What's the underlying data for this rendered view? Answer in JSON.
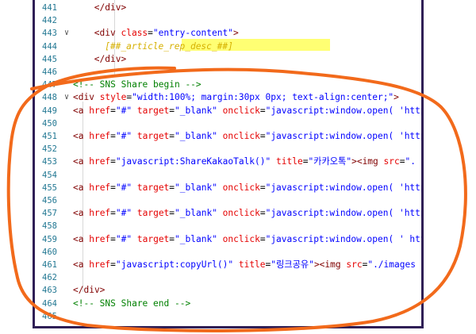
{
  "editor": {
    "highlight_color": "#ffff00",
    "annotation_color": "#f26a1b",
    "frame_color": "#2f1f56",
    "lines": [
      {
        "n": "441",
        "fold": "",
        "tokens": [
          {
            "c": "tag",
            "t": "</div>"
          }
        ],
        "indent": 4
      },
      {
        "n": "442",
        "fold": "",
        "tokens": [],
        "indent": 0
      },
      {
        "n": "443",
        "fold": "∨",
        "tokens": [
          {
            "c": "tag",
            "t": "<div "
          },
          {
            "c": "attr",
            "t": "class"
          },
          {
            "c": "txt",
            "t": "="
          },
          {
            "c": "str",
            "t": "\"entry-content\""
          },
          {
            "c": "tag",
            "t": ">"
          }
        ],
        "indent": 4
      },
      {
        "n": "444",
        "fold": "",
        "tokens": [
          {
            "c": "ph",
            "t": "[##_article_rep_desc_##]"
          }
        ],
        "indent": 6
      },
      {
        "n": "445",
        "fold": "",
        "tokens": [
          {
            "c": "tag",
            "t": "</div>"
          }
        ],
        "indent": 4
      },
      {
        "n": "446",
        "fold": "",
        "tokens": [],
        "indent": 0
      },
      {
        "n": "447",
        "fold": "",
        "tokens": [
          {
            "c": "com",
            "t": "<!-- SNS Share begin -->"
          }
        ],
        "indent": 0
      },
      {
        "n": "448",
        "fold": "∨",
        "tokens": [
          {
            "c": "tag",
            "t": "<div "
          },
          {
            "c": "attr",
            "t": "style"
          },
          {
            "c": "txt",
            "t": "="
          },
          {
            "c": "str",
            "t": "\"width:100%; margin:30px 0px; text-align:center;\""
          },
          {
            "c": "tag",
            "t": ">"
          }
        ],
        "indent": 0
      },
      {
        "n": "449",
        "fold": "",
        "tokens": [
          {
            "c": "tag",
            "t": "<a "
          },
          {
            "c": "attr",
            "t": "href"
          },
          {
            "c": "txt",
            "t": "="
          },
          {
            "c": "str",
            "t": "\"#\" "
          },
          {
            "c": "attr",
            "t": "target"
          },
          {
            "c": "txt",
            "t": "="
          },
          {
            "c": "str",
            "t": "\"_blank\" "
          },
          {
            "c": "attr",
            "t": "onclick"
          },
          {
            "c": "txt",
            "t": "="
          },
          {
            "c": "str",
            "t": "\"javascript:window.open( 'http"
          }
        ],
        "indent": 0
      },
      {
        "n": "450",
        "fold": "",
        "tokens": [],
        "indent": 0
      },
      {
        "n": "451",
        "fold": "",
        "tokens": [
          {
            "c": "tag",
            "t": "<a "
          },
          {
            "c": "attr",
            "t": "href"
          },
          {
            "c": "txt",
            "t": "="
          },
          {
            "c": "str",
            "t": "\"#\" "
          },
          {
            "c": "attr",
            "t": "target"
          },
          {
            "c": "txt",
            "t": "="
          },
          {
            "c": "str",
            "t": "\"_blank\" "
          },
          {
            "c": "attr",
            "t": "onclick"
          },
          {
            "c": "txt",
            "t": "="
          },
          {
            "c": "str",
            "t": "\"javascript:window.open( 'http"
          }
        ],
        "indent": 0
      },
      {
        "n": "452",
        "fold": "",
        "tokens": [],
        "indent": 0
      },
      {
        "n": "453",
        "fold": "",
        "tokens": [
          {
            "c": "tag",
            "t": "<a "
          },
          {
            "c": "attr",
            "t": "href"
          },
          {
            "c": "txt",
            "t": "="
          },
          {
            "c": "str",
            "t": "\"javascript:ShareKakaoTalk()\" "
          },
          {
            "c": "attr",
            "t": "title"
          },
          {
            "c": "txt",
            "t": "="
          },
          {
            "c": "str",
            "t": "\"카카오톡\""
          },
          {
            "c": "tag",
            "t": "><img "
          },
          {
            "c": "attr",
            "t": "src"
          },
          {
            "c": "txt",
            "t": "="
          },
          {
            "c": "str",
            "t": "\"."
          }
        ],
        "indent": 0
      },
      {
        "n": "454",
        "fold": "",
        "tokens": [],
        "indent": 0
      },
      {
        "n": "455",
        "fold": "",
        "tokens": [
          {
            "c": "tag",
            "t": "<a "
          },
          {
            "c": "attr",
            "t": "href"
          },
          {
            "c": "txt",
            "t": "="
          },
          {
            "c": "str",
            "t": "\"#\" "
          },
          {
            "c": "attr",
            "t": "target"
          },
          {
            "c": "txt",
            "t": "="
          },
          {
            "c": "str",
            "t": "\"_blank\" "
          },
          {
            "c": "attr",
            "t": "onclick"
          },
          {
            "c": "txt",
            "t": "="
          },
          {
            "c": "str",
            "t": "\"javascript:window.open( 'http"
          }
        ],
        "indent": 0
      },
      {
        "n": "456",
        "fold": "",
        "tokens": [],
        "indent": 0
      },
      {
        "n": "457",
        "fold": "",
        "tokens": [
          {
            "c": "tag",
            "t": "<a "
          },
          {
            "c": "attr",
            "t": "href"
          },
          {
            "c": "txt",
            "t": "="
          },
          {
            "c": "str",
            "t": "\"#\" "
          },
          {
            "c": "attr",
            "t": "target"
          },
          {
            "c": "txt",
            "t": "="
          },
          {
            "c": "str",
            "t": "\"_blank\" "
          },
          {
            "c": "attr",
            "t": "onclick"
          },
          {
            "c": "txt",
            "t": "="
          },
          {
            "c": "str",
            "t": "\"javascript:window.open( 'http"
          }
        ],
        "indent": 0
      },
      {
        "n": "458",
        "fold": "",
        "tokens": [],
        "indent": 0
      },
      {
        "n": "459",
        "fold": "",
        "tokens": [
          {
            "c": "tag",
            "t": "<a "
          },
          {
            "c": "attr",
            "t": "href"
          },
          {
            "c": "txt",
            "t": "="
          },
          {
            "c": "str",
            "t": "\"#\" "
          },
          {
            "c": "attr",
            "t": "target"
          },
          {
            "c": "txt",
            "t": "="
          },
          {
            "c": "str",
            "t": "\"_blank\" "
          },
          {
            "c": "attr",
            "t": "onclick"
          },
          {
            "c": "txt",
            "t": "="
          },
          {
            "c": "str",
            "t": "\"javascript:window.open( ' htt"
          }
        ],
        "indent": 0
      },
      {
        "n": "460",
        "fold": "",
        "tokens": [],
        "indent": 0
      },
      {
        "n": "461",
        "fold": "",
        "tokens": [
          {
            "c": "tag",
            "t": "<a "
          },
          {
            "c": "attr",
            "t": "href"
          },
          {
            "c": "txt",
            "t": "="
          },
          {
            "c": "str",
            "t": "\"javascript:copyUrl()\" "
          },
          {
            "c": "attr",
            "t": "title"
          },
          {
            "c": "txt",
            "t": "="
          },
          {
            "c": "str",
            "t": "\"링크공유\""
          },
          {
            "c": "tag",
            "t": "><img "
          },
          {
            "c": "attr",
            "t": "src"
          },
          {
            "c": "txt",
            "t": "="
          },
          {
            "c": "str",
            "t": "\"./images"
          }
        ],
        "indent": 0
      },
      {
        "n": "462",
        "fold": "",
        "tokens": [],
        "indent": 0
      },
      {
        "n": "463",
        "fold": "",
        "tokens": [
          {
            "c": "tag",
            "t": "</div>"
          }
        ],
        "indent": 0
      },
      {
        "n": "464",
        "fold": "",
        "tokens": [
          {
            "c": "com",
            "t": "<!-- SNS Share end -->"
          }
        ],
        "indent": 0
      },
      {
        "n": "465",
        "fold": "",
        "tokens": [],
        "indent": 0
      }
    ]
  }
}
